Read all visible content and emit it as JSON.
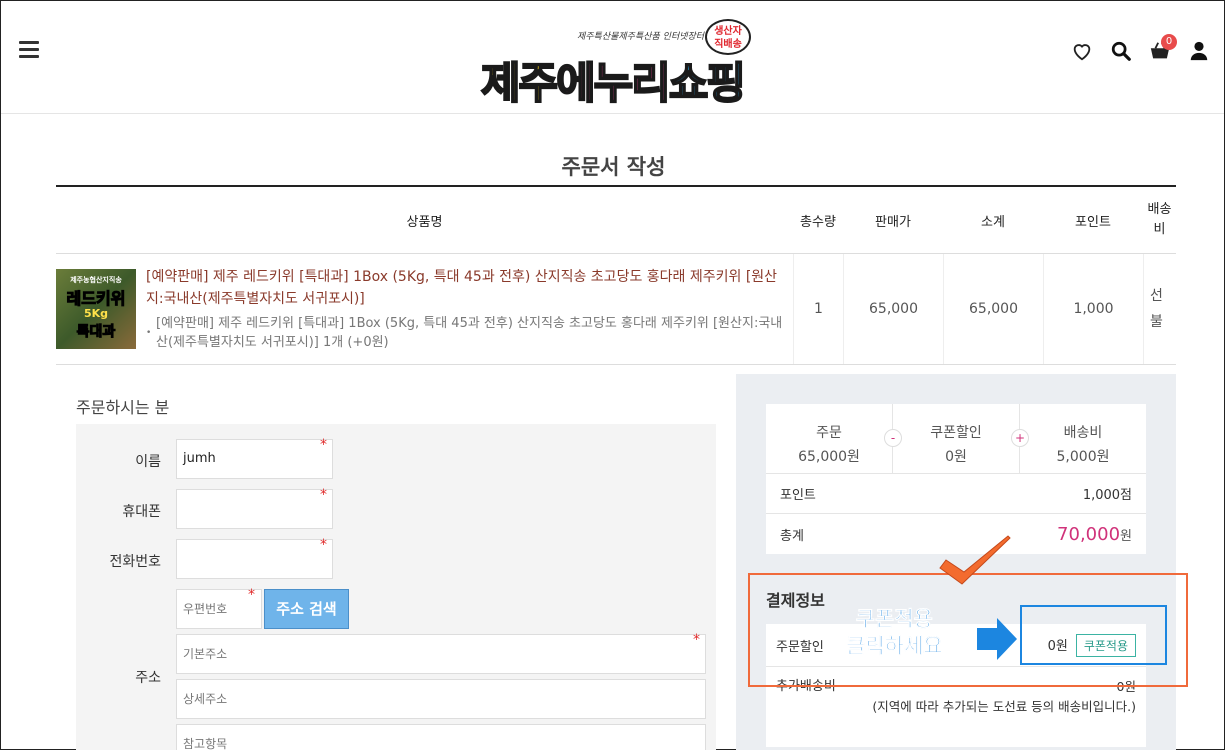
{
  "header": {
    "logo_main": [
      "제주",
      "에누리",
      "쇼핑"
    ],
    "logo_tagline": "제주특산물제주특산품 인터넷장터",
    "logo_badge": [
      "생산자",
      "직배송"
    ],
    "cart_count": "0",
    "icons": [
      "menu-icon",
      "heart-icon",
      "search-icon",
      "cart-icon",
      "user-icon"
    ]
  },
  "page_title": "주문서 작성",
  "table": {
    "headers": {
      "name": "상품명",
      "qty": "총수량",
      "price": "판매가",
      "subtotal": "소계",
      "point": "포인트",
      "shipping": "배송비"
    },
    "row": {
      "thumb_text": [
        "제주농협산지직송",
        "레드키위",
        "5Kg",
        "특대과"
      ],
      "product_name": "[예약판매] 제주 레드키위 [특대과] 1Box (5Kg, 특대 45과 전후) 산지직송 초고당도 홍다래 제주키위 [원산지:국내산(제주특별자치도 서귀포시)]",
      "option_text": "[예약판매] 제주 레드키위 [특대과] 1Box (5Kg, 특대 45과 전후) 산지직송 초고당도 홍다래 제주키위 [원산지:국내산(제주특별자치도 서귀포시)] 1개 (+0원)",
      "qty": "1",
      "price": "65,000",
      "subtotal": "65,000",
      "point": "1,000",
      "shipping": "선불"
    }
  },
  "buyer": {
    "title": "주문하시는 분",
    "name_label": "이름",
    "name_value": "jumh",
    "mobile_label": "휴대폰",
    "phone_label": "전화번호",
    "address_label": "주소",
    "zip_placeholder": "우편번호",
    "addr_search_button": "주소 검색",
    "addr1_placeholder": "기본주소",
    "addr2_placeholder": "상세주소",
    "addr3_placeholder": "참고항목",
    "required_mark": "*"
  },
  "summary": {
    "order_label": "주문",
    "order_value": "65,000원",
    "minus": "-",
    "coupon_label": "쿠폰할인",
    "coupon_value": "0원",
    "plus": "+",
    "shipping_label": "배송비",
    "shipping_value": "5,000원",
    "point_label": "포인트",
    "point_value": "1,000점",
    "total_label": "총계",
    "total_value": "70,000",
    "total_unit": "원"
  },
  "payment": {
    "title": "결제정보",
    "order_discount_label": "주문할인",
    "order_discount_value": "0원",
    "coupon_button": "쿠폰적용",
    "extra_ship_label": "추가배송비",
    "extra_ship_value": "0원",
    "extra_ship_note": "(지역에 따라 추가되는 도선료 등의 배송비입니다.)"
  },
  "annotation": {
    "line1": "쿠폰적용",
    "line2": "클릭하세요"
  }
}
